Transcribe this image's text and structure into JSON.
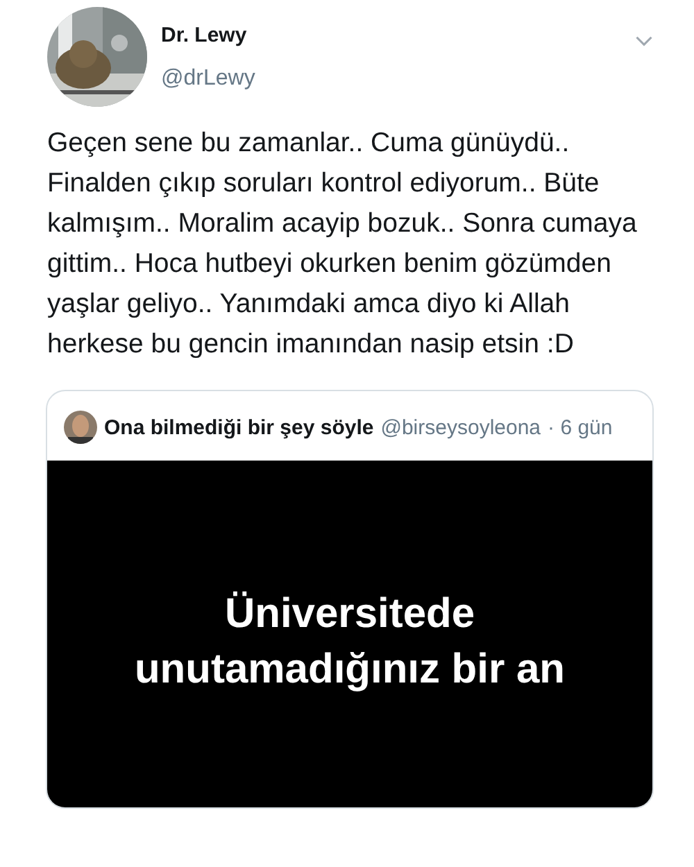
{
  "author": {
    "name": "Dr. Lewy",
    "handle": "@drLewy"
  },
  "tweet_text": "Geçen sene bu zamanlar.. Cuma günüydü.. Finalden çıkıp soruları kontrol ediyorum.. Büte kalmışım.. Moralim acayip bozuk.. Sonra cumaya gittim.. Hoca hutbeyi okurken benim gözümden yaşlar geliyo.. Yanımdaki amca diyo ki Allah herkese bu gencin imanından nasip etsin :D",
  "quoted_tweet": {
    "name": "Ona bilmediği bir şey söyle",
    "handle": "@birseysoyleona",
    "time": "· 6 gün",
    "media": {
      "lines": [
        "Üniversitede",
        "unutamadığınız bir an"
      ]
    }
  }
}
